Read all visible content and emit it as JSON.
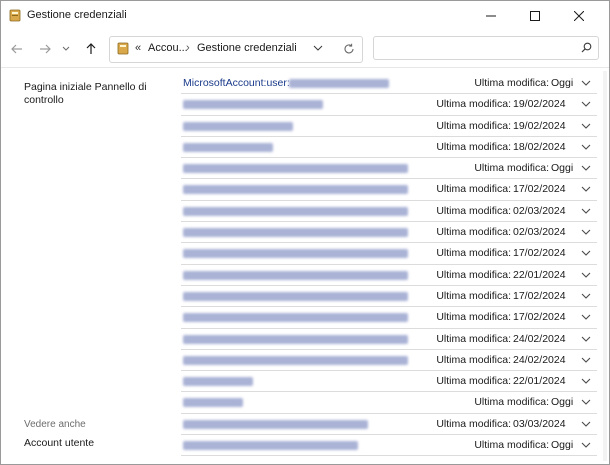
{
  "window": {
    "title": "Gestione credenziali"
  },
  "address": {
    "overflow": "«",
    "crumb1": "Accou...",
    "separator": "›",
    "crumb2": "Gestione credenziali"
  },
  "search": {
    "placeholder": ""
  },
  "left": {
    "home_link": "Pagina iniziale Pannello di controllo",
    "see_also": "Vedere anche",
    "user_accounts": "Account utente"
  },
  "credentials": [
    {
      "name": "MicrosoftAccount:user:",
      "mod_label": "Ultima modifica:",
      "mod_value": "Oggi"
    },
    {
      "name": "",
      "mod_label": "Ultima modifica:",
      "mod_value": "19/02/2024"
    },
    {
      "name": "",
      "mod_label": "Ultima modifica:",
      "mod_value": "19/02/2024"
    },
    {
      "name": "",
      "mod_label": "Ultima modifica:",
      "mod_value": "18/02/2024"
    },
    {
      "name": "",
      "mod_label": "Ultima modifica:",
      "mod_value": "Oggi"
    },
    {
      "name": "",
      "mod_label": "Ultima modifica:",
      "mod_value": "17/02/2024"
    },
    {
      "name": "",
      "mod_label": "Ultima modifica:",
      "mod_value": "02/03/2024"
    },
    {
      "name": "",
      "mod_label": "Ultima modifica:",
      "mod_value": "02/03/2024"
    },
    {
      "name": "",
      "mod_label": "Ultima modifica:",
      "mod_value": "17/02/2024"
    },
    {
      "name": "",
      "mod_label": "Ultima modifica:",
      "mod_value": "22/01/2024"
    },
    {
      "name": "",
      "mod_label": "Ultima modifica:",
      "mod_value": "17/02/2024"
    },
    {
      "name": "",
      "mod_label": "Ultima modifica:",
      "mod_value": "17/02/2024"
    },
    {
      "name": "",
      "mod_label": "Ultima modifica:",
      "mod_value": "24/02/2024"
    },
    {
      "name": "",
      "mod_label": "Ultima modifica:",
      "mod_value": "24/02/2024"
    },
    {
      "name": "",
      "mod_label": "Ultima modifica:",
      "mod_value": "22/01/2024"
    },
    {
      "name": "",
      "mod_label": "Ultima modifica:",
      "mod_value": "Oggi"
    },
    {
      "name": "",
      "mod_label": "Ultima modifica:",
      "mod_value": "03/03/2024"
    },
    {
      "name": "",
      "mod_label": "Ultima modifica:",
      "mod_value": "Oggi"
    }
  ],
  "colors": {
    "link": "#1a3a8a",
    "blur": "#aab3d6",
    "divider": "#dcdcdc"
  }
}
